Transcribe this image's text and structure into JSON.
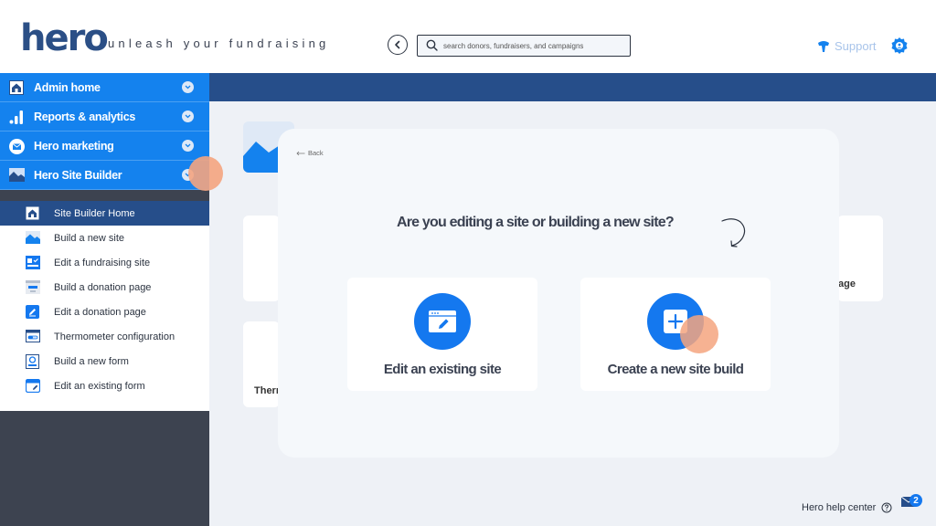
{
  "header": {
    "logo": "hero",
    "tagline": "unleash your fundraising",
    "search": {
      "placeholder": "search donors, fundraisers, and campaigns",
      "value": ""
    },
    "support_label": "Support"
  },
  "sidebar": {
    "nav": [
      {
        "label": "Admin home",
        "icon": "home-icon"
      },
      {
        "label": "Reports & analytics",
        "icon": "bar-chart-icon"
      },
      {
        "label": "Hero marketing",
        "icon": "mail-icon"
      },
      {
        "label": "Hero Site Builder",
        "icon": "image-icon"
      }
    ],
    "site_builder_items": [
      {
        "label": "Site Builder Home",
        "icon": "home-icon",
        "active": true
      },
      {
        "label": "Build a new site",
        "icon": "image-icon"
      },
      {
        "label": "Edit a fundraising site",
        "icon": "site-edit-icon"
      },
      {
        "label": "Build a donation page",
        "icon": "page-icon"
      },
      {
        "label": "Edit a donation page",
        "icon": "pencil-icon"
      },
      {
        "label": "Thermometer configuration",
        "icon": "thermometer-icon"
      },
      {
        "label": "Build a new form",
        "icon": "form-icon"
      },
      {
        "label": "Edit an existing form",
        "icon": "form-edit-icon"
      }
    ]
  },
  "background": {
    "partial_text_1": "age",
    "partial_text_2": "Therr"
  },
  "modal": {
    "back_label": "Back",
    "question": "Are you editing a site or building a new site?",
    "options": [
      {
        "label": "Edit an existing site",
        "icon": "browser-edit-icon"
      },
      {
        "label": "Create a new site build",
        "icon": "plus-icon"
      }
    ]
  },
  "footer": {
    "help_center": "Hero help center",
    "mail_badge": "2"
  },
  "colors": {
    "primary_blue": "#1482ee",
    "navy": "#264e8a",
    "sidebar_dark": "#3d4350",
    "highlight": "#f4a47f"
  }
}
